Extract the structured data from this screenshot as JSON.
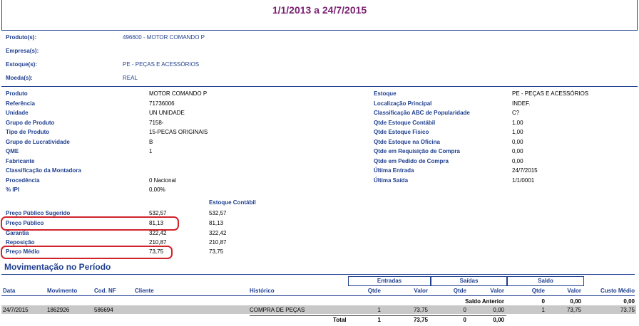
{
  "header": {
    "title": "1/1/2013 a 24/7/2015"
  },
  "filters": [
    {
      "label": "Produto(s):",
      "value": "496600 - MOTOR COMANDO P"
    },
    {
      "label": "Empresa(s):",
      "value": ""
    },
    {
      "label": "Estoque(s):",
      "value": "PE - PEÇAS E ACESSÓRIOS"
    },
    {
      "label": "Moeda(s):",
      "value": "REAL"
    }
  ],
  "details_left": [
    {
      "label": "Produto",
      "value": "MOTOR COMANDO P"
    },
    {
      "label": "Referência",
      "value": "71736006"
    },
    {
      "label": "Unidade",
      "value": "UN UNIDADE"
    },
    {
      "label": "Grupo de Produto",
      "value": "7158-"
    },
    {
      "label": "Tipo de Produto",
      "value": "15-PECAS ORIGINAIS"
    },
    {
      "label": "Grupo de Lucratividade",
      "value": "B"
    },
    {
      "label": "QME",
      "value": "1"
    },
    {
      "label": "Fabricante",
      "value": ""
    },
    {
      "label": "Classificação da Montadora",
      "value": ""
    },
    {
      "label": "Procedência",
      "value": "0 Nacional"
    },
    {
      "label": "% IPI",
      "value": "0,00%"
    }
  ],
  "details_right": [
    {
      "label": "Estoque",
      "value": "PE - PEÇAS E ACESSÓRIOS"
    },
    {
      "label": "Localização Principal",
      "value": "INDEF."
    },
    {
      "label": "Classificação ABC de Popularidade",
      "value": "C?"
    },
    {
      "label": "Qtde Estoque Contábil",
      "value": "1,00"
    },
    {
      "label": "Qtde Estoque Físico",
      "value": "1,00"
    },
    {
      "label": "Qtde Estoque na Oficina",
      "value": "0,00"
    },
    {
      "label": "Qtde em Requisição de Compra",
      "value": "0,00"
    },
    {
      "label": "Qtde em Pedido de Compra",
      "value": "0,00"
    },
    {
      "label": "Última Entrada",
      "value": "24/7/2015"
    },
    {
      "label": "Última Saída",
      "value": "1/1/0001"
    }
  ],
  "prices": {
    "column_header": "Estoque Contábil",
    "rows": [
      {
        "label": "Preço Público Sugerido",
        "value": "532,57",
        "contabil": "532,57"
      },
      {
        "label": "Preço Público",
        "value": "81,13",
        "contabil": "81,13"
      },
      {
        "label": "Garantia",
        "value": "322,42",
        "contabil": "322,42"
      },
      {
        "label": "Reposição",
        "value": "210,87",
        "contabil": "210,87"
      },
      {
        "label": "Preço Médio",
        "value": "73,75",
        "contabil": "73,75"
      }
    ]
  },
  "movement": {
    "section_title": "Movimentação no Período",
    "groups": {
      "entradas": "Entradas",
      "saidas": "Saídas",
      "saldo": "Saldo"
    },
    "columns": {
      "data": "Data",
      "movimento": "Movimento",
      "cod_nf": "Cod. NF",
      "cliente": "Cliente",
      "historico": "Histórico",
      "qtde": "Qtde",
      "valor": "Valor",
      "custo_medio": "Custo Médio"
    },
    "saldo_anterior": {
      "label": "Saldo Anterior",
      "qtde": "0",
      "valor": "0,00",
      "custo": "0,00"
    },
    "row": {
      "data": "24/7/2015",
      "movimento": "1862926",
      "cod_nf": "586694",
      "cliente": "",
      "historico": "COMPRA DE PEÇAS",
      "ent_qtde": "1",
      "ent_valor": "73,75",
      "sai_qtde": "0",
      "sai_valor": "0,00",
      "sal_qtde": "1",
      "sal_valor": "73,75",
      "custo": "73,75"
    },
    "total": {
      "label": "Total",
      "ent_qtde": "1",
      "ent_valor": "73,75",
      "sai_qtde": "0",
      "sai_valor": "0,00"
    }
  },
  "colors": {
    "accent": "#1f3f8f",
    "title": "#7a1f70",
    "highlight": "#d2232a",
    "row_bg": "#c8c8c8"
  }
}
